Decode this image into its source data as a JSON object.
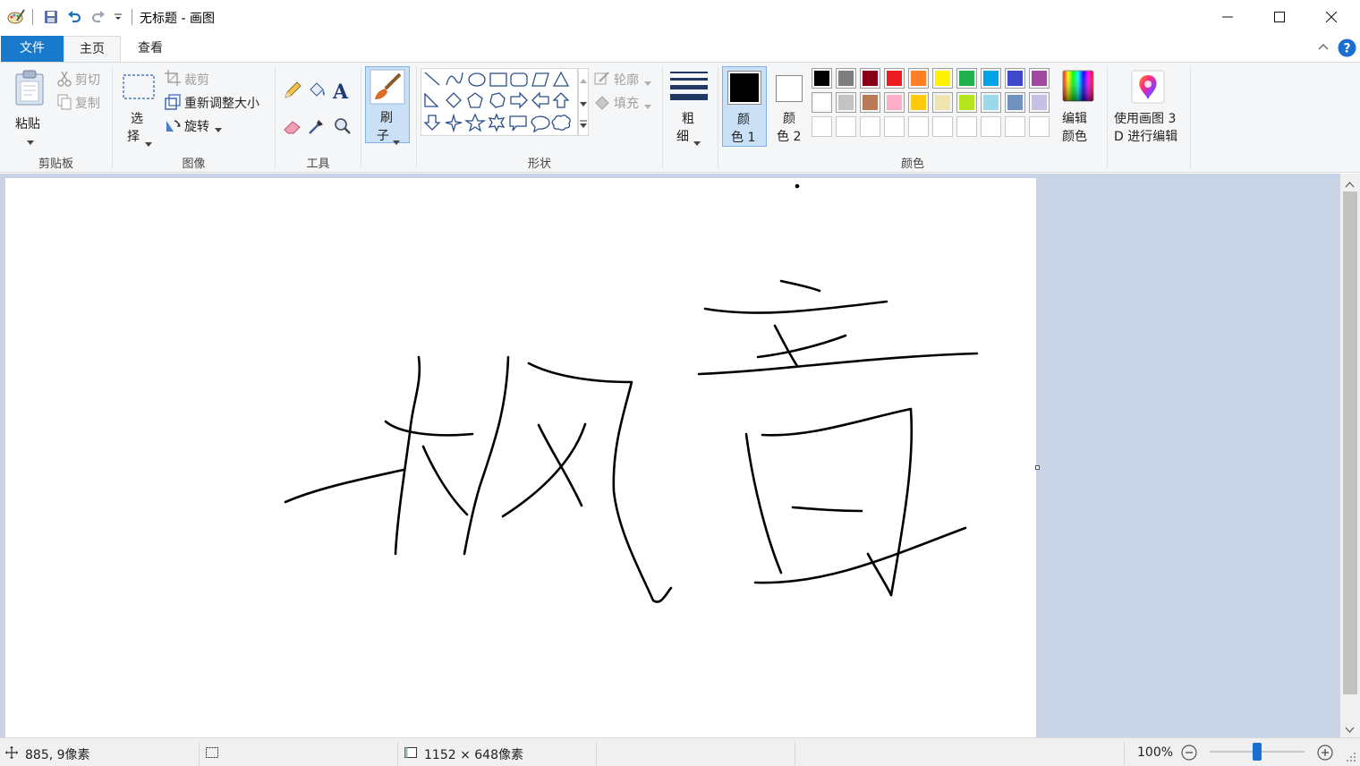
{
  "window": {
    "title": "无标题 - 画图",
    "minimize": "—",
    "maximize": "☐",
    "close": "✕"
  },
  "tabs": [
    "文件",
    "主页",
    "查看"
  ],
  "clipboard": {
    "paste": "粘贴",
    "cut": "剪切",
    "copy": "复制",
    "group_label": "剪贴板"
  },
  "image": {
    "select_line1": "选",
    "select_line2": "择",
    "crop": "裁剪",
    "resize": "重新调整大小",
    "rotate": "旋转",
    "group_label": "图像"
  },
  "tools": {
    "group_label": "工具",
    "text_tool": "A"
  },
  "brush": {
    "line1": "刷",
    "line2": "子"
  },
  "shapes": {
    "outline": "轮廓",
    "fill": "填充",
    "group_label": "形状"
  },
  "size": {
    "line1": "粗",
    "line2": "细"
  },
  "colors": {
    "color1_line1": "颜",
    "color1_line2": "色 1",
    "color2_line1": "颜",
    "color2_line2": "色 2",
    "edit_line1": "编辑",
    "edit_line2": "颜色",
    "paint3d_line1": "使用画图 3",
    "paint3d_line2": "D 进行编辑",
    "group_label": "颜色",
    "color1_value": "#000000",
    "color2_value": "#ffffff",
    "palette_row1": [
      "#000000",
      "#7f7f7f",
      "#880015",
      "#ed1c24",
      "#ff7f27",
      "#fff200",
      "#22b14c",
      "#00a2e8",
      "#3f48cc",
      "#a349a4"
    ],
    "palette_row2": [
      "#ffffff",
      "#c3c3c3",
      "#b97a57",
      "#ffaec9",
      "#ffc90e",
      "#efe4b0",
      "#b5e61d",
      "#99d9ea",
      "#7092be",
      "#c8bfe7"
    ]
  },
  "status": {
    "cursor_pos": "885, 9像素",
    "canvas_size": "1152 × 648像素",
    "zoom": "100%",
    "zoom_level": 1.0
  }
}
